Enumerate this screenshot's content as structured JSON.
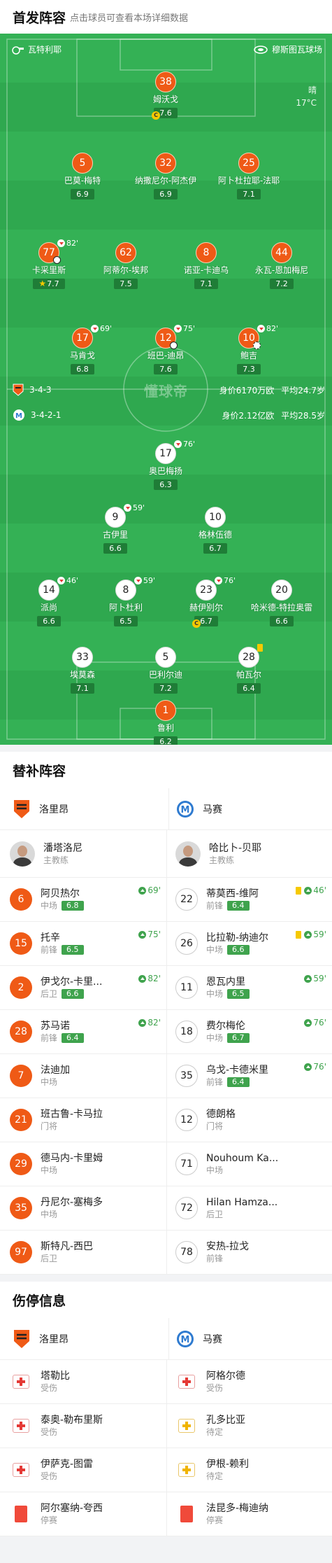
{
  "header": {
    "title": "首发阵容",
    "subtitle": "点击球员可查看本场详细数据"
  },
  "pitch": {
    "home_team": "瓦特利耶",
    "away_team": "穆斯图瓦球场",
    "weather": "晴",
    "temperature": "17°C",
    "logo_text": "懂球帝",
    "home_formation": "3-4-3",
    "home_value": "身价6170万欧",
    "home_age": "平均24.7岁",
    "away_formation": "3-4-2-1",
    "away_value": "身价2.12亿欧",
    "away_age": "平均28.5岁"
  },
  "home_players": [
    {
      "num": "38",
      "name": "姆沃戈",
      "rating": "7.6",
      "captain": true
    },
    {
      "num": "5",
      "name": "巴莫-梅特",
      "rating": "6.9"
    },
    {
      "num": "32",
      "name": "纳撒尼尔-阿杰伊",
      "rating": "6.9"
    },
    {
      "num": "25",
      "name": "阿卜杜拉耶-法耶",
      "rating": "7.1"
    },
    {
      "num": "77",
      "name": "卡采里斯",
      "rating": "7.7",
      "sub_minute": "82'",
      "goal": true,
      "motm": true
    },
    {
      "num": "62",
      "name": "阿蒂尔-埃邦",
      "rating": "7.5"
    },
    {
      "num": "8",
      "name": "诺亚-卡迪乌",
      "rating": "7.1"
    },
    {
      "num": "44",
      "name": "永瓦-恩加梅尼",
      "rating": "7.2"
    },
    {
      "num": "17",
      "name": "马肯戈",
      "rating": "6.8",
      "sub_minute": "69'"
    },
    {
      "num": "12",
      "name": "班巴-迪昂",
      "rating": "7.6",
      "sub_minute": "75'",
      "goal": true
    },
    {
      "num": "10",
      "name": "鲍吉",
      "rating": "7.3",
      "sub_minute": "82'",
      "assist": true
    }
  ],
  "away_players": [
    {
      "num": "17",
      "name": "奥巴梅扬",
      "rating": "6.3",
      "sub_minute": "76'"
    },
    {
      "num": "9",
      "name": "古伊里",
      "rating": "6.6",
      "sub_minute": "59'"
    },
    {
      "num": "10",
      "name": "格林伍德",
      "rating": "6.7"
    },
    {
      "num": "14",
      "name": "派尚",
      "rating": "6.6",
      "sub_minute": "46'"
    },
    {
      "num": "8",
      "name": "阿卜杜利",
      "rating": "6.5",
      "sub_minute": "59'"
    },
    {
      "num": "23",
      "name": "赫伊别尔",
      "rating": "6.7",
      "sub_minute": "76'",
      "captain": true
    },
    {
      "num": "20",
      "name": "哈米德-特拉奥雷",
      "rating": "6.6"
    },
    {
      "num": "33",
      "name": "埃莫森",
      "rating": "7.1"
    },
    {
      "num": "5",
      "name": "巴利尔迪",
      "rating": "7.2"
    },
    {
      "num": "28",
      "name": "帕瓦尔",
      "rating": "6.4",
      "yellow": true
    },
    {
      "num": "1",
      "name": "鲁利",
      "rating": "6.2"
    }
  ],
  "subs": {
    "title": "替补阵容",
    "home_team": "洛里昂",
    "away_team": "马赛",
    "home_coach": {
      "name": "潘塔洛尼",
      "role": "主教练"
    },
    "away_coach": {
      "name": "哈比卜-贝耶",
      "role": "主教练"
    },
    "home": [
      {
        "num": "6",
        "name": "阿贝热尔",
        "pos": "中场",
        "rating": "6.8",
        "in": "69'"
      },
      {
        "num": "15",
        "name": "托辛",
        "pos": "前锋",
        "rating": "6.5",
        "in": "75'"
      },
      {
        "num": "2",
        "name": "伊戈尔-卡里...",
        "pos": "后卫",
        "rating": "6.6",
        "in": "82'"
      },
      {
        "num": "28",
        "name": "苏马诺",
        "pos": "前锋",
        "rating": "6.4",
        "in": "82'"
      },
      {
        "num": "7",
        "name": "法迪加",
        "pos": "中场"
      },
      {
        "num": "21",
        "name": "班古鲁-卡马拉",
        "pos": "门将"
      },
      {
        "num": "29",
        "name": "德马内-卡里姆",
        "pos": "中场"
      },
      {
        "num": "35",
        "name": "丹尼尔-塞梅多",
        "pos": "中场"
      },
      {
        "num": "97",
        "name": "斯特凡-西巴",
        "pos": "后卫"
      }
    ],
    "away": [
      {
        "num": "22",
        "name": "蒂莫西-维阿",
        "pos": "前锋",
        "rating": "6.4",
        "in": "46'",
        "yellow": true
      },
      {
        "num": "26",
        "name": "比拉勒-纳迪尔",
        "pos": "中场",
        "rating": "6.6",
        "in": "59'",
        "yellow": true
      },
      {
        "num": "11",
        "name": "恩瓦内里",
        "pos": "中场",
        "rating": "6.5",
        "in": "59'"
      },
      {
        "num": "18",
        "name": "费尔梅伦",
        "pos": "中场",
        "rating": "6.7",
        "in": "76'"
      },
      {
        "num": "35",
        "name": "乌戈-卡德米里",
        "pos": "前锋",
        "rating": "6.4",
        "in": "76'"
      },
      {
        "num": "12",
        "name": "德朗格",
        "pos": "门将"
      },
      {
        "num": "71",
        "name": "Nouhoum Ka...",
        "pos": "中场"
      },
      {
        "num": "72",
        "name": "Hilan Hamza...",
        "pos": "后卫"
      },
      {
        "num": "78",
        "name": "安热-拉戈",
        "pos": "前锋"
      }
    ]
  },
  "injuries": {
    "title": "伤停信息",
    "home_team": "洛里昂",
    "away_team": "马赛",
    "home": [
      {
        "name": "塔勒比",
        "status": "受伤",
        "icon": "medkit-red-icon"
      },
      {
        "name": "泰奥-勒布里斯",
        "status": "受伤",
        "icon": "medkit-red-icon"
      },
      {
        "name": "伊萨克-图雷",
        "status": "受伤",
        "icon": "medkit-red-icon"
      },
      {
        "name": "阿尔塞纳-夸西",
        "status": "停赛",
        "icon": "red-card-icon"
      }
    ],
    "away": [
      {
        "name": "阿格尔德",
        "status": "受伤",
        "icon": "medkit-red-icon"
      },
      {
        "name": "孔多比亚",
        "status": "待定",
        "icon": "medkit-yellow-icon"
      },
      {
        "name": "伊根-赖利",
        "status": "待定",
        "icon": "medkit-yellow-icon"
      },
      {
        "name": "法昆多-梅迪纳",
        "status": "停赛",
        "icon": "red-card-icon"
      }
    ]
  },
  "colors": {
    "pitch": "#2fa84f",
    "home": "#ef5a16",
    "rating": "#1f7d37",
    "sub_in": "#3fa34d"
  }
}
